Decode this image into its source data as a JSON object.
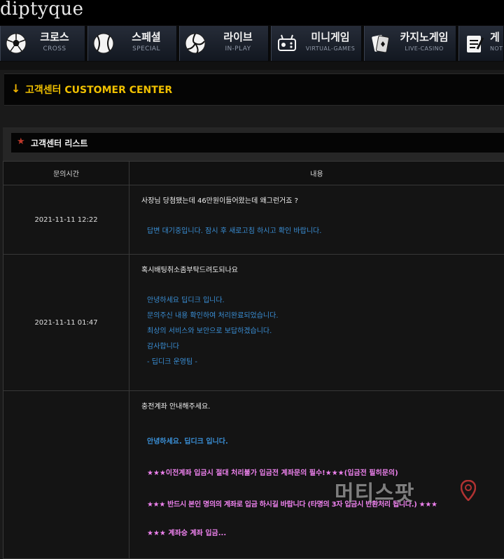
{
  "brand": {
    "logo_text": "diptyque"
  },
  "nav": [
    {
      "ko": "크로스",
      "en": "CROSS",
      "icon": "soccer-ball-icon"
    },
    {
      "ko": "스페셜",
      "en": "SPECIAL",
      "icon": "baseball-icon"
    },
    {
      "ko": "라이브",
      "en": "IN-PLAY",
      "icon": "volleyball-icon"
    },
    {
      "ko": "미니게임",
      "en": "VIRTUAL-GAMES",
      "icon": "mini-game-icon"
    },
    {
      "ko": "카지노게임",
      "en": "LIVE-CASINO",
      "icon": "casino-cards-icon"
    },
    {
      "ko": "게",
      "en": "NOT",
      "icon": "notepad-icon"
    }
  ],
  "customer_center": {
    "title": "고객센터 CUSTOMER CENTER"
  },
  "list": {
    "title": "고객센터 리스트",
    "columns": {
      "time": "문의시간",
      "content": "내용"
    },
    "rows": [
      {
        "time": "2021-11-11 12:22",
        "question": "사장님 당첨됐는데 46만원이들어왔는데 왜그런거죠 ?",
        "answer": [
          "답변 대기중입니다. 잠시 후 새로고침 하시고 확인 바랍니다."
        ]
      },
      {
        "time": "2021-11-11 01:47",
        "question": "혹시배팅취소좀부탁드려도되나요",
        "answer": [
          "안녕하세요 딥디크 입니다.",
          "문의주신 내용 확인하여 처리완료되었습니다.",
          "최상의 서비스와 보안으로 보답하겠습니다.",
          "감사합니다",
          "- 딥디크 운영팀 -"
        ]
      },
      {
        "time": "",
        "question": "충전계좌 안내해주세요.",
        "answer_greeting": "안녕하세요. 딥디크 입니다.",
        "notices": [
          "★★★이전계좌 입금시 절대 처리불가 입금전 계좌문의 필수!★★★(입금전 필히문의)",
          "★★★ 반드시 본인 명의의 계좌로 입금 하시길 바랍니다 (타명의 3자 입금시 반환처리 됩니다.) ★★★",
          "★★★ 계좌승 계좌 입금..."
        ]
      }
    ]
  },
  "watermark": {
    "text": "머티스팟"
  }
}
